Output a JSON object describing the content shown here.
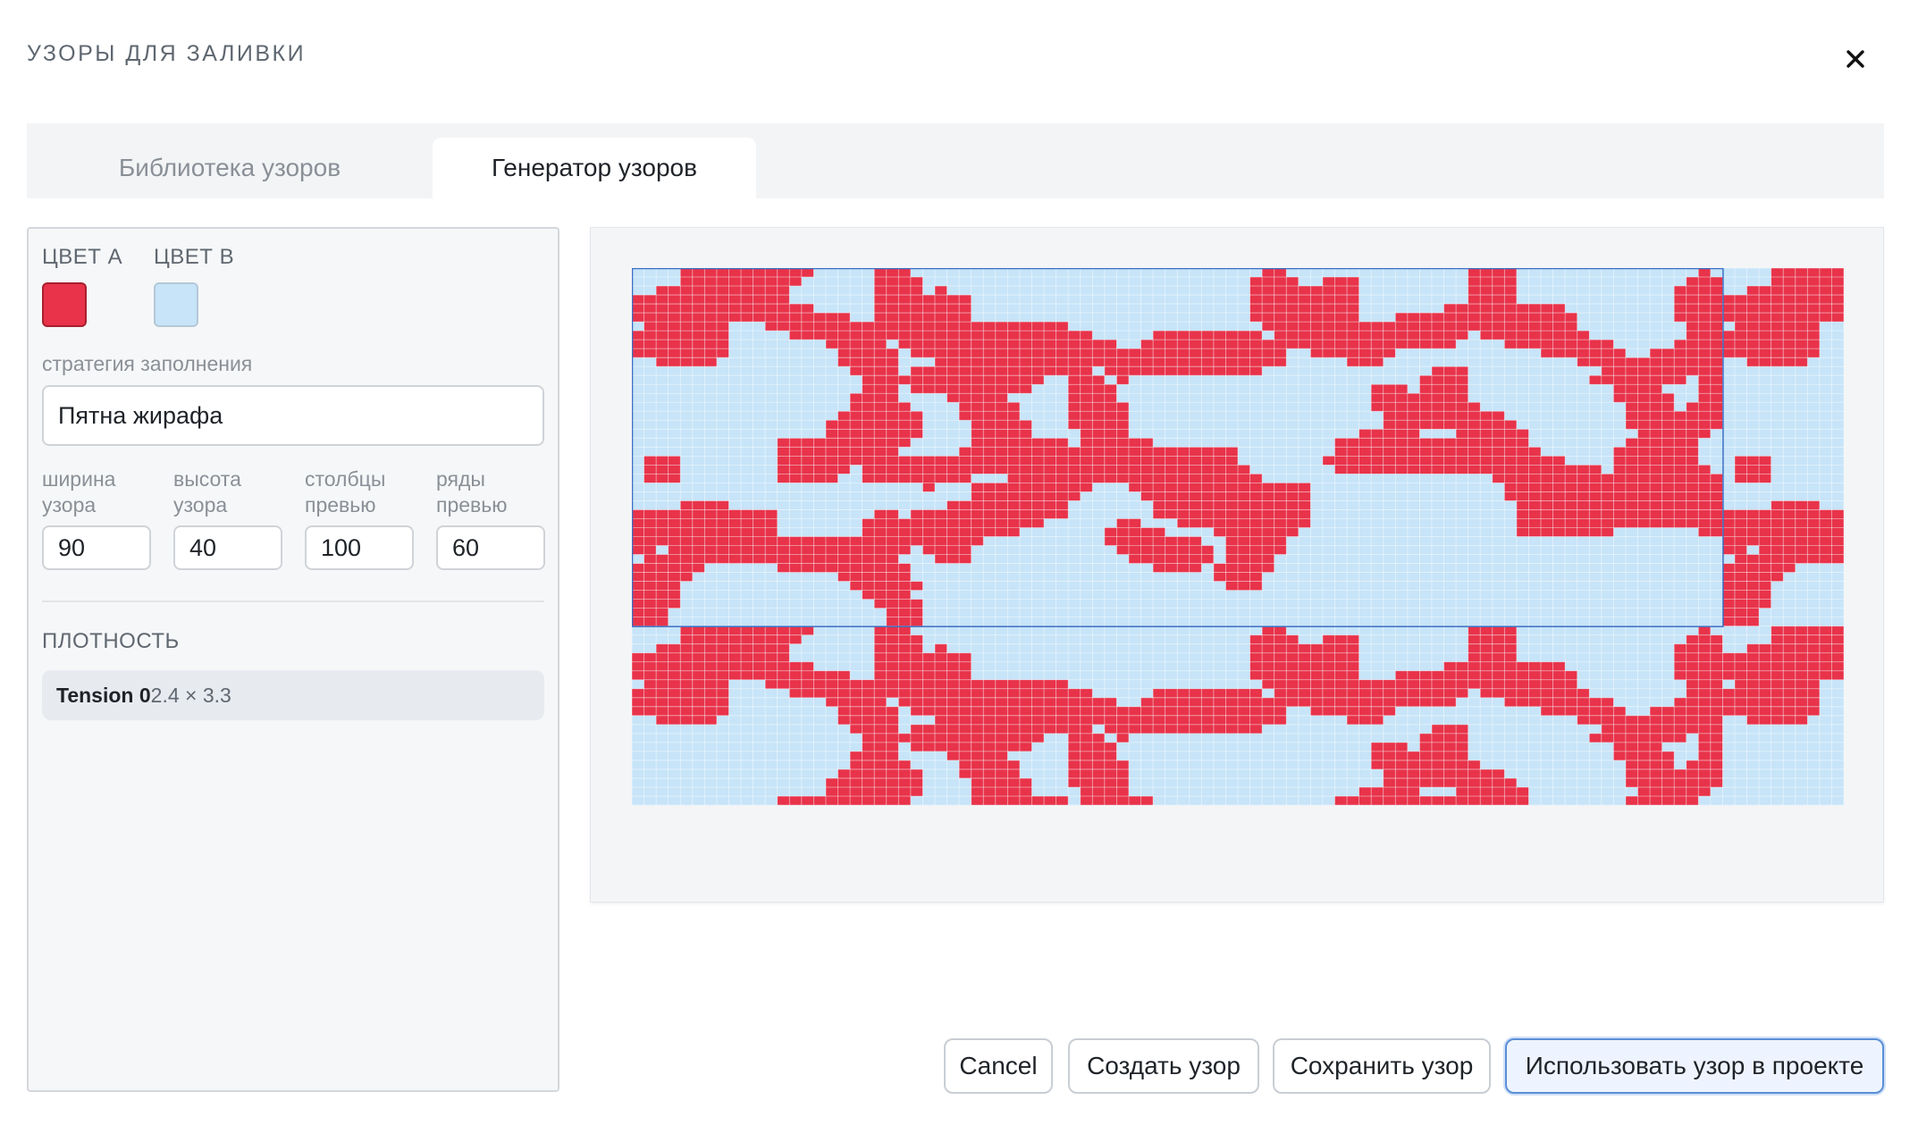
{
  "dialog": {
    "title": "УЗОРЫ ДЛЯ ЗАЛИВКИ",
    "close_icon": "close-icon"
  },
  "tabs": [
    {
      "label": "Библиотека узоров",
      "active": false
    },
    {
      "label": "Генератор узоров",
      "active": true
    }
  ],
  "settings": {
    "color_a": {
      "label": "ЦВЕТ А",
      "value": "#e8334a"
    },
    "color_b": {
      "label": "ЦВЕТ В",
      "value": "#c7e4f8"
    },
    "fill_strategy": {
      "label": "стратегия заполнения",
      "value": "Пятна жирафа"
    },
    "pattern_width": {
      "label_line1": "ширина",
      "label_line2": "узора",
      "value": "90"
    },
    "pattern_height": {
      "label_line1": "высота",
      "label_line2": "узора",
      "value": "40"
    },
    "preview_cols": {
      "label_line1": "столбцы",
      "label_line2": "превью",
      "value": "100"
    },
    "preview_rows": {
      "label_line1": "ряды",
      "label_line2": "превью",
      "value": "60"
    },
    "density": {
      "label": "ПЛОТНОСТЬ",
      "name": "Tension 0",
      "size": "2.4 × 3.3"
    }
  },
  "preview": {
    "pattern_cols": 90,
    "pattern_rows": 40,
    "cols": 100,
    "rows": 60,
    "color_a": "#e8334a",
    "color_b": "#c7e4f8",
    "frame_color": "#3a6fc4"
  },
  "actions": {
    "cancel": "Cancel",
    "create": "Создать узор",
    "save": "Сохранить узор",
    "use": "Использовать узор в проекте"
  }
}
